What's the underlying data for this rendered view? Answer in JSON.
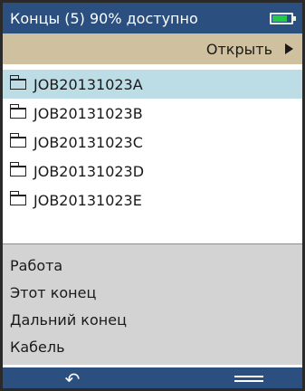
{
  "title": "Концы (5) 90% доступно",
  "battery": {
    "level_fraction": 0.8,
    "color": "#25c84a"
  },
  "open_bar": {
    "label": "Открыть"
  },
  "folders": [
    {
      "name": "JOB20131023A",
      "selected": true
    },
    {
      "name": "JOB20131023B",
      "selected": false
    },
    {
      "name": "JOB20131023C",
      "selected": false
    },
    {
      "name": "JOB20131023D",
      "selected": false
    },
    {
      "name": "JOB20131023E",
      "selected": false
    }
  ],
  "menu": {
    "items": [
      {
        "label": "Работа"
      },
      {
        "label": "Этот конец"
      },
      {
        "label": "Дальний конец"
      },
      {
        "label": "Кабель"
      }
    ]
  },
  "bottom_bar": {
    "back_icon": "back-arrow-icon",
    "back_glyph": "↶",
    "menu_icon": "hamburger-menu-icon"
  },
  "colors": {
    "header": "#2b4f7e",
    "open_bar": "#cfc0a0",
    "selected_row": "#bcdce6",
    "menu_panel": "#d3d3d3"
  }
}
